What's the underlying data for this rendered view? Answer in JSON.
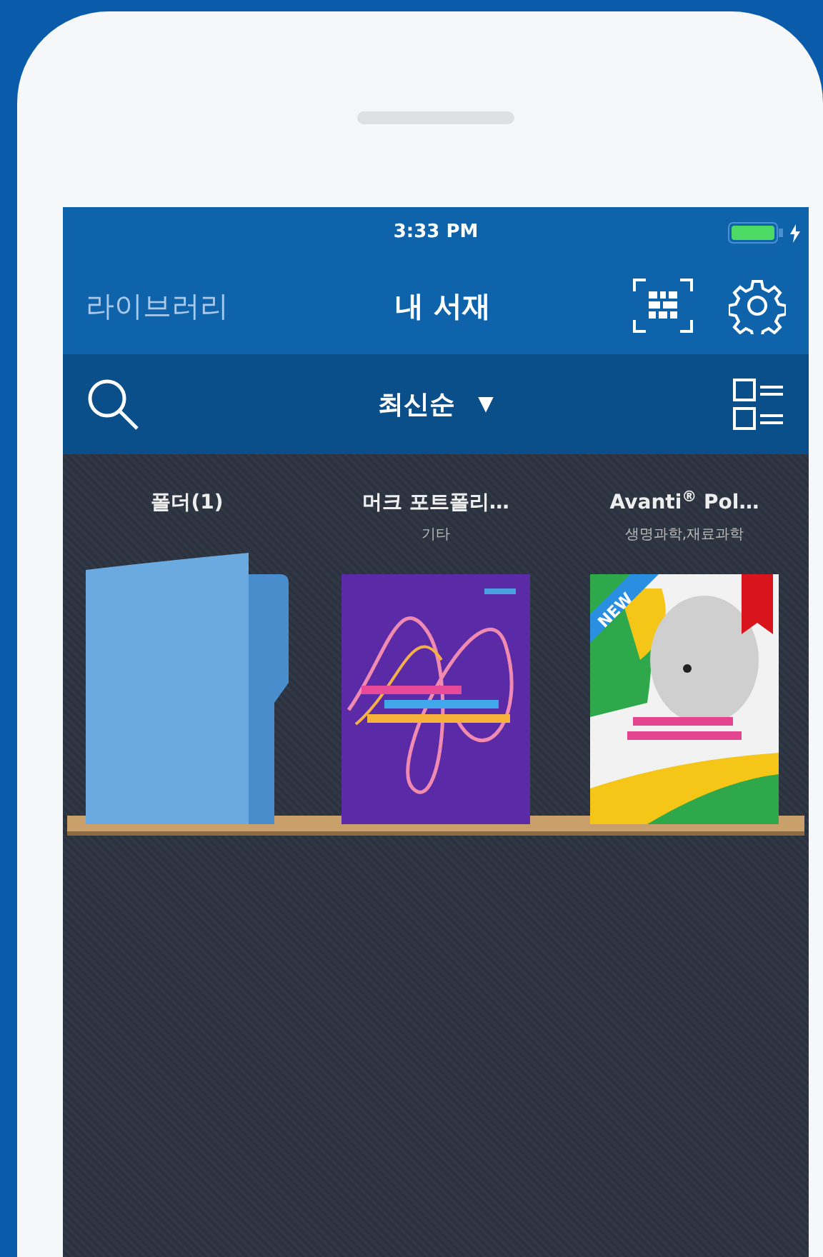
{
  "status_bar": {
    "time": "3:33 PM",
    "charging": true
  },
  "nav": {
    "back": "라이브러리",
    "title": "내 서재"
  },
  "toolbar": {
    "sort": "최신순",
    "sort_caret": "▼"
  },
  "shelf": [
    {
      "kind": "folder",
      "title": "폴더(1)"
    },
    {
      "kind": "wavebook",
      "title": "머크 포트폴리…",
      "subtitle": "기타",
      "bookmarked": false
    },
    {
      "kind": "photobook",
      "title": "Avanti$^{®}$ Pol…",
      "subtitle": "생명과학,재료과학",
      "badge": "NEW",
      "bookmarked": true
    }
  ]
}
